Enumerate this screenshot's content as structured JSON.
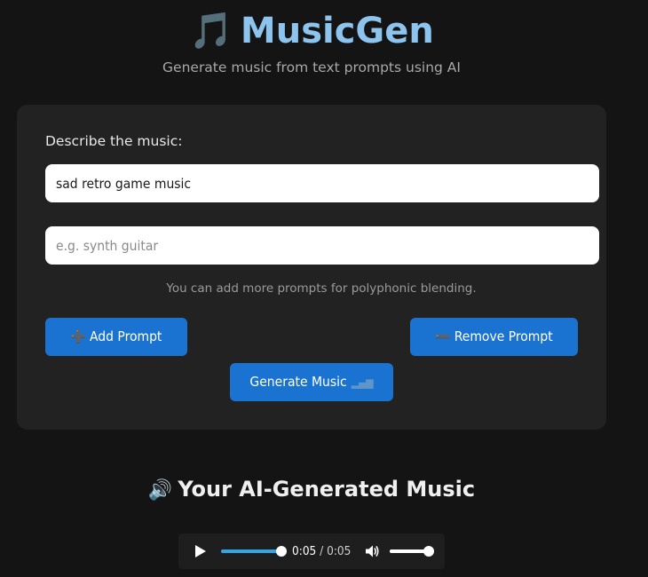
{
  "header": {
    "title": "MusicGen",
    "title_icon": "musical-notes-icon",
    "subtitle": "Generate music from text prompts using AI"
  },
  "form": {
    "label": "Describe the music:",
    "prompts": [
      {
        "value": "sad retro game music",
        "placeholder": ""
      },
      {
        "value": "",
        "placeholder": "e.g. synth guitar"
      }
    ],
    "hint": "You can add more prompts for polyphonic blending.",
    "add_button": {
      "label": "Add Prompt",
      "icon": "plus-icon"
    },
    "remove_button": {
      "label": "Remove Prompt",
      "icon": "minus-icon"
    },
    "generate_button": {
      "label": "Generate Music",
      "icon": "equalizer-icon"
    }
  },
  "result": {
    "heading": "Your AI-Generated Music",
    "heading_icon": "speaker-icon",
    "player": {
      "current_time": "0:05",
      "separator": "/",
      "duration": "0:05",
      "progress_fraction": 1.0,
      "volume_fraction": 1.0
    }
  },
  "colors": {
    "background": "#141414",
    "card": "#222222",
    "title": "#8cc4ee",
    "button": "#1a73d0",
    "progress": "#2fa6e8"
  }
}
